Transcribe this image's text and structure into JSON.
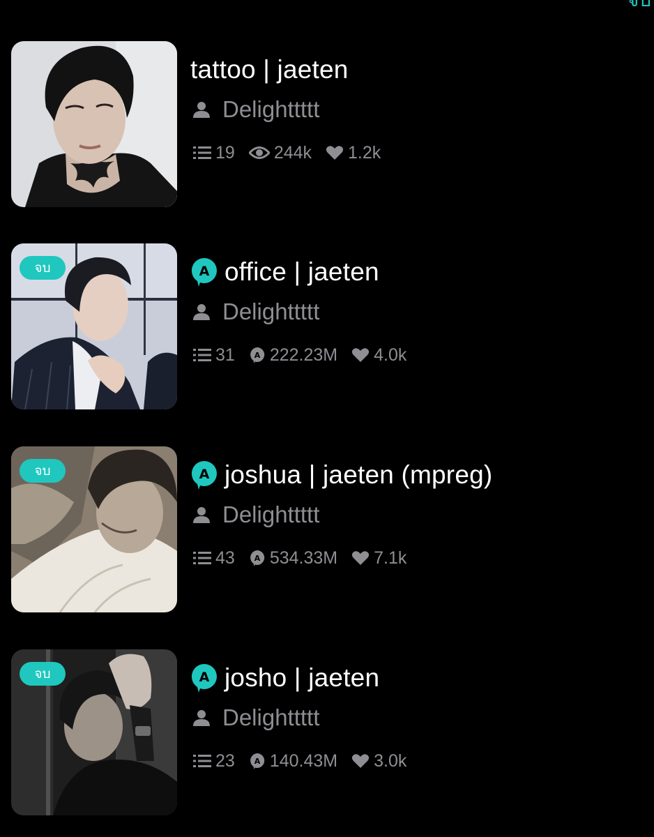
{
  "theme": {
    "accent": "#1fc7be",
    "background": "#000000",
    "text_primary": "#ffffff",
    "text_secondary": "#8e8e93"
  },
  "header_partial_text": "จบ",
  "stories": [
    {
      "title": "tattoo | jaeten",
      "author": "Delighttttt",
      "badge": "",
      "ad_icon": false,
      "chapters": "19",
      "views_icon": "eye-icon",
      "views": "244k",
      "likes": "1.2k"
    },
    {
      "title": "office | jaeten",
      "author": "Delighttttt",
      "badge": "จบ",
      "ad_icon": true,
      "chapters": "31",
      "views_icon": "coin-a-icon",
      "views": "222.23M",
      "likes": "4.0k"
    },
    {
      "title": "joshua | jaeten (mpreg)",
      "author": "Delighttttt",
      "badge": "จบ",
      "ad_icon": true,
      "chapters": "43",
      "views_icon": "coin-a-icon",
      "views": "534.33M",
      "likes": "7.1k"
    },
    {
      "title": "josho | jaeten",
      "author": "Delighttttt",
      "badge": "จบ",
      "ad_icon": true,
      "chapters": "23",
      "views_icon": "coin-a-icon",
      "views": "140.43M",
      "likes": "3.0k"
    }
  ]
}
